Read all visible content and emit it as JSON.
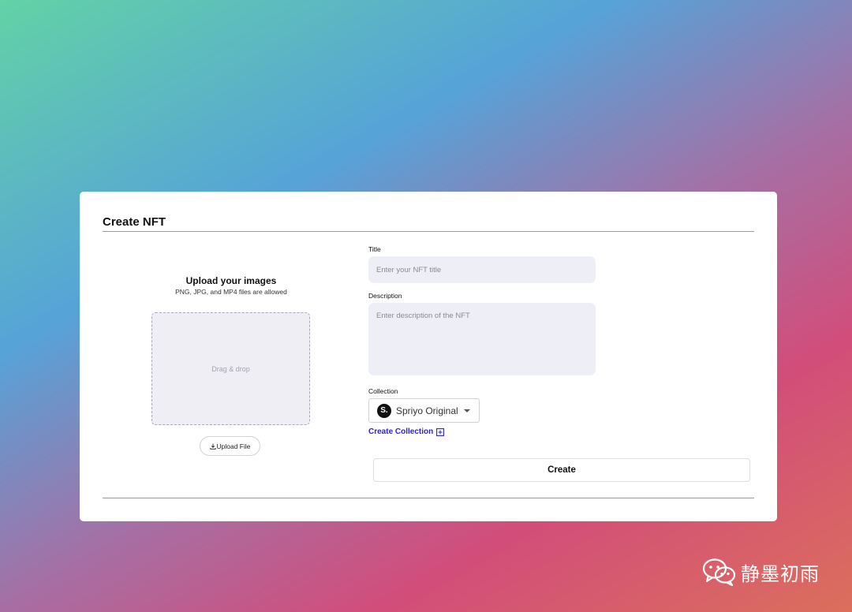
{
  "card": {
    "title": "Create NFT"
  },
  "upload": {
    "heading": "Upload your images",
    "hint": "PNG, JPG, and MP4 files are allowed",
    "dropzone_text": "Drag & drop",
    "button_label": "Upload File",
    "button_icon": "upload-icon"
  },
  "form": {
    "title_label": "Title",
    "title_placeholder": "Enter your NFT title",
    "title_value": "",
    "description_label": "Description",
    "description_placeholder": "Enter description of the NFT",
    "description_value": "",
    "collection_label": "Collection",
    "collection_selected": "Spriyo Original",
    "collection_logo_letter": "S.",
    "create_collection_label": "Create Collection",
    "create_collection_icon": "plus-square-icon",
    "submit_label": "Create"
  },
  "colors": {
    "link": "#2d22d9",
    "input_bg": "#eeeef6"
  },
  "watermark": {
    "icon": "wechat-icon",
    "text": "静墨初雨"
  }
}
